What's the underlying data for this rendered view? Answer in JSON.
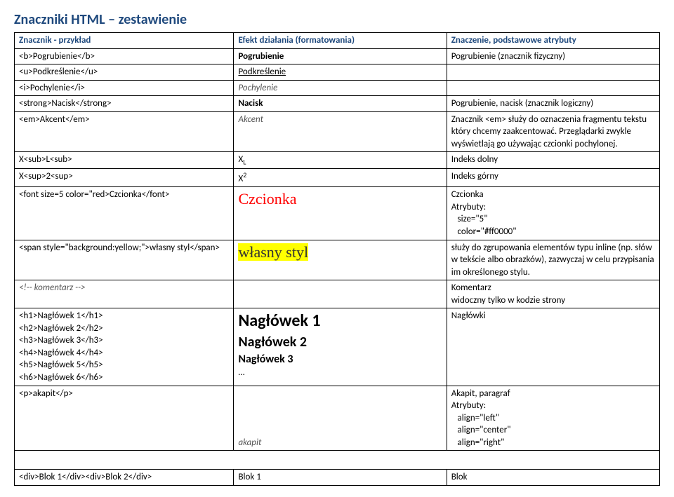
{
  "title": "Znaczniki HTML – zestawienie",
  "headers": {
    "col1": "Znacznik - przykład",
    "col2": "Efekt działania (formatowania)",
    "col3": "Znaczenie, podstawowe atrybuty"
  },
  "rows": {
    "bold": {
      "ex": "<b>Pogrubienie</b>",
      "eff": "Pogrubienie",
      "mean": "Pogrubienie (znacznik fizyczny)"
    },
    "under": {
      "ex": "<u>Podkreślenie</u>",
      "eff": "Podkreślenie",
      "mean": ""
    },
    "italic": {
      "ex": "<i>Pochylenie</i>",
      "eff": "Pochylenie",
      "mean": ""
    },
    "strong": {
      "ex": "<strong>Nacisk</strong>",
      "eff": "Nacisk",
      "mean": "Pogrubienie, nacisk (znacznik logiczny)"
    },
    "em": {
      "ex": "<em>Akcent</em>",
      "eff": "Akcent",
      "mean": "Znacznik <em> służy do oznaczenia fragmentu tekstu który chcemy zaakcentować. Przeglądarki zwykle wyświetlają go używając czcionki pochylonej."
    },
    "sub": {
      "ex": "X<sub>L<sub>",
      "eff_main": "X",
      "eff_sub": "L",
      "mean": "Indeks dolny"
    },
    "sup": {
      "ex": "X<sup>2<sup>",
      "eff_main": "X",
      "eff_sup": "2",
      "mean": "Indeks górny"
    },
    "font": {
      "ex": "<font size=5 color=\"red>Czcionka</font>",
      "eff": "Czcionka",
      "mean": "Czcionka\nAtrybuty:\n   size=\"5\"\n   color=\"#ff0000\""
    },
    "span": {
      "ex": "<span style=\"background:yellow;\">własny styl</span>",
      "eff": "własny styl",
      "mean": "służy do zgrupowania elementów typu inline (np. słów w tekście albo obrazków), zazwyczaj w celu przypisania im określonego stylu."
    },
    "comment": {
      "ex": "<!-- komentarz -->",
      "eff": "",
      "mean": "Komentarz\nwidoczny tylko w kodzie strony"
    },
    "headings": {
      "ex": "<h1>Nagłówek 1</h1>\n<h2>Nagłówek 2</h2>\n<h3>Nagłówek 3</h3>\n<h4>Nagłówek 4</h4>\n<h5>Nagłówek 5</h5>\n<h6>Nagłówek 6</h6>",
      "eff_h1": "Nagłówek 1",
      "eff_h2": "Nagłówek 2",
      "eff_h3": "Nagłówek 3",
      "eff_dots": "…",
      "mean": "Nagłówki"
    },
    "p": {
      "ex": "<p>akapit</p>",
      "eff": "akapit",
      "mean": "Akapit, paragraf\nAtrybuty:\n   align=\"left\"\n   align=\"center\"\n   align=\"right\""
    },
    "div": {
      "ex": "<div>Blok 1</div><div>Blok 2</div>",
      "eff": "Blok 1",
      "mean": "Blok"
    }
  }
}
